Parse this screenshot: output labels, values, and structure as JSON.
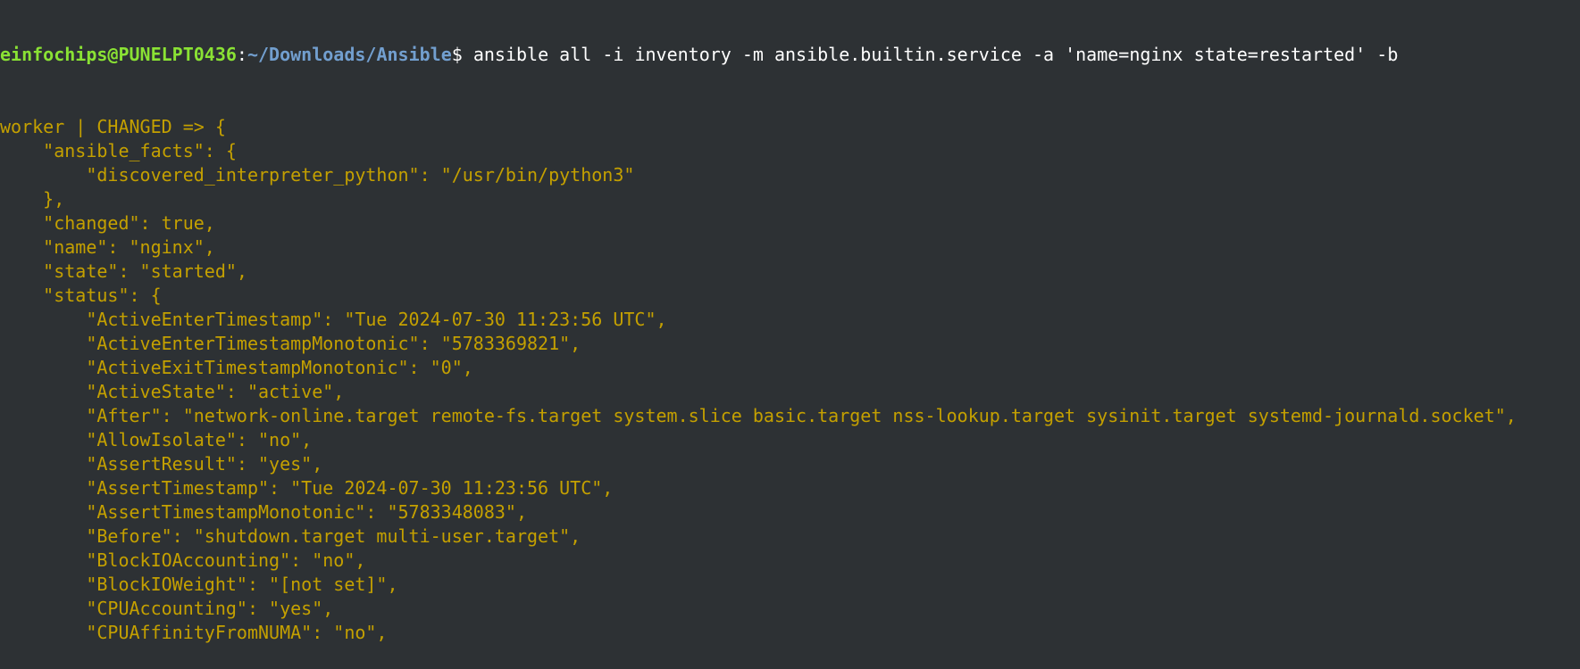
{
  "prompt": {
    "user_host": "einfochips@PUNELPT0436",
    "colon": ":",
    "path": "~/Downloads/Ansible",
    "symbol": "$ ",
    "command": "ansible all -i inventory -m ansible.builtin.service -a 'name=nginx state=restarted' -b"
  },
  "colors": {
    "background": "#2d3134",
    "user": "#8ae234",
    "path": "#729fcf",
    "output": "#c4a000",
    "command": "#ffffff"
  },
  "output_lines": [
    "worker | CHANGED => {",
    "    \"ansible_facts\": {",
    "        \"discovered_interpreter_python\": \"/usr/bin/python3\"",
    "    },",
    "    \"changed\": true,",
    "    \"name\": \"nginx\",",
    "    \"state\": \"started\",",
    "    \"status\": {",
    "        \"ActiveEnterTimestamp\": \"Tue 2024-07-30 11:23:56 UTC\",",
    "        \"ActiveEnterTimestampMonotonic\": \"5783369821\",",
    "        \"ActiveExitTimestampMonotonic\": \"0\",",
    "        \"ActiveState\": \"active\",",
    "        \"After\": \"network-online.target remote-fs.target system.slice basic.target nss-lookup.target sysinit.target systemd-journald.socket\",",
    "        \"AllowIsolate\": \"no\",",
    "        \"AssertResult\": \"yes\",",
    "        \"AssertTimestamp\": \"Tue 2024-07-30 11:23:56 UTC\",",
    "        \"AssertTimestampMonotonic\": \"5783348083\",",
    "        \"Before\": \"shutdown.target multi-user.target\",",
    "        \"BlockIOAccounting\": \"no\",",
    "        \"BlockIOWeight\": \"[not set]\",",
    "        \"CPUAccounting\": \"yes\",",
    "        \"CPUAffinityFromNUMA\": \"no\","
  ]
}
